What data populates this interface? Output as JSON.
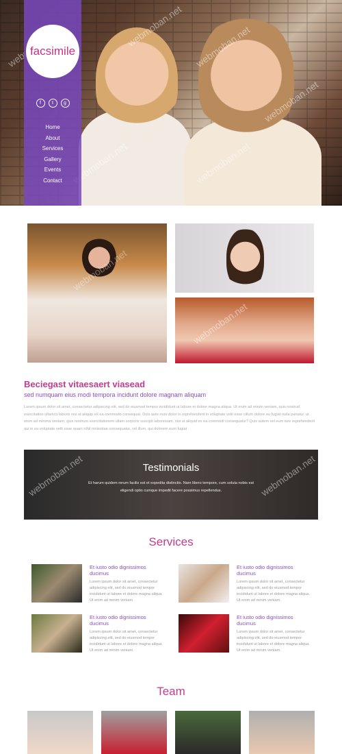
{
  "brand": {
    "logo_text": "facsimile"
  },
  "socials": [
    {
      "icon": "facebook-icon",
      "glyph": "f"
    },
    {
      "icon": "twitter-icon",
      "glyph": "t"
    },
    {
      "icon": "google-plus-icon",
      "glyph": "g"
    }
  ],
  "nav": [
    "Home",
    "About",
    "Services",
    "Gallery",
    "Events",
    "Contact"
  ],
  "intro": {
    "title": "Beciegast vitaesaert viasead",
    "subtitle": "sed numquam eius modi tempora incidunt dolore magnam aliquam",
    "body": "Lorem ipsum dolor sit amet, consectetur adipiscing elit, sed do eiusmod tempor incididunt ut labore et dolore magna aliqua. Ut enim ad minim veniam, quis nostrud exercitation ullamco laboris nisi ut aliquip ex ea commodo consequat. Duis aute irure dolor in reprehenderit in voluptate velit esse cillum dolore eu fugiat nulla pariatur. ut enim ad minima veniam, quis nostrum exercitationem ullam corporis suscipit laboriosam, nisi ut aliquid ex ea commodi consequatur? Quis autem vel eum iure reprehenderit qui in ea voluptate velit esse quam nihil molestiae consequatur, vel illum, qui dolorem eum fugiat"
  },
  "testimonials": {
    "title": "Testimonials",
    "text": "Et harum quidem rerum facilis est et expedita distinctio. Nam libero tempore, cum soluta nobis est eligendi optio cumque impedit facere possimus repellendus."
  },
  "services": {
    "title": "Services",
    "items": [
      {
        "title": "Et iusto odio dignissimos ducimus",
        "text": "Lorem ipsum dolor sit amet, consectetur adipiscing elit, sed do eiusmod tempor incididunt ut labore et dolore magna aliqua. Ut enim ad minim veniam."
      },
      {
        "title": "Et iusto odio dignissimos ducimus",
        "text": "Lorem ipsum dolor sit amet, consectetur adipiscing elit, sed do eiusmod tempor incididunt ut labore et dolore magna aliqua. Ut enim ad minim veniam."
      },
      {
        "title": "Et iusto odio dignissimos ducimus",
        "text": "Lorem ipsum dolor sit amet, consectetur adipiscing elit, sed do eiusmod tempor incididunt ut labore et dolore magna aliqua. Ut enim ad minim veniam."
      },
      {
        "title": "Et iusto odio dignissimos ducimus",
        "text": "Lorem ipsum dolor sit amet, consectetur adipiscing elit, sed do eiusmod tempor incididunt ut labore et dolore magna aliqua. Ut enim ad minim veniam."
      }
    ]
  },
  "team": {
    "title": "Team"
  },
  "watermark": "webmoban.net",
  "colors": {
    "accent": "#c13b8f",
    "sidebar": "#7848be",
    "subtitle": "#8a4fbf"
  }
}
